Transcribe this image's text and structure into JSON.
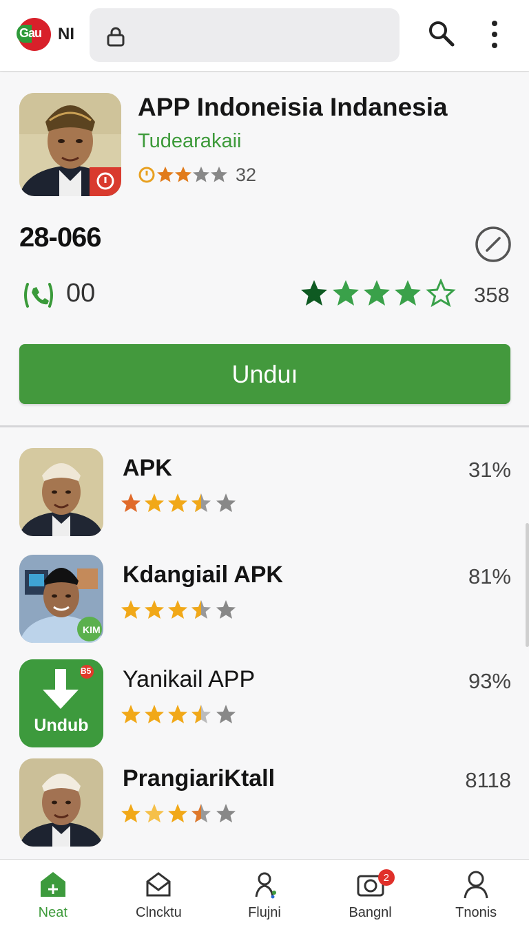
{
  "topbar": {
    "logo_badge": "Gau",
    "logo_text": "NI",
    "url": ""
  },
  "app": {
    "title": "APP Indoneisia Indanesia",
    "developer": "Tudearakaii",
    "rating_count": "32",
    "version": "28-066",
    "phone_count": "00",
    "rating_value": "358",
    "download_label": "Unduı"
  },
  "list": [
    {
      "title": "APK",
      "percent": "31%",
      "stars": 3.5
    },
    {
      "title": "Kdangiail APK",
      "percent": "81%",
      "stars": 3.5
    },
    {
      "title": "Yanikail APP",
      "percent": "93%",
      "stars": 3.5,
      "icon_label": "Undub",
      "icon_badge": "B5"
    },
    {
      "title": "PrangiariKtall",
      "percent": "8118",
      "stars": 3.5
    }
  ],
  "nav": [
    {
      "label": "Neat",
      "icon": "home-icon"
    },
    {
      "label": "Clncktu",
      "icon": "mail-icon"
    },
    {
      "label": "Flujni",
      "icon": "person-refresh-icon"
    },
    {
      "label": "Bangnl",
      "icon": "camera-icon",
      "badge": "2"
    },
    {
      "label": "Tnonis",
      "icon": "person-icon"
    }
  ],
  "colors": {
    "accent_green": "#43993d",
    "star_gold": "#f1a818",
    "star_gray": "#888888",
    "star_green": "#3aa14a"
  }
}
